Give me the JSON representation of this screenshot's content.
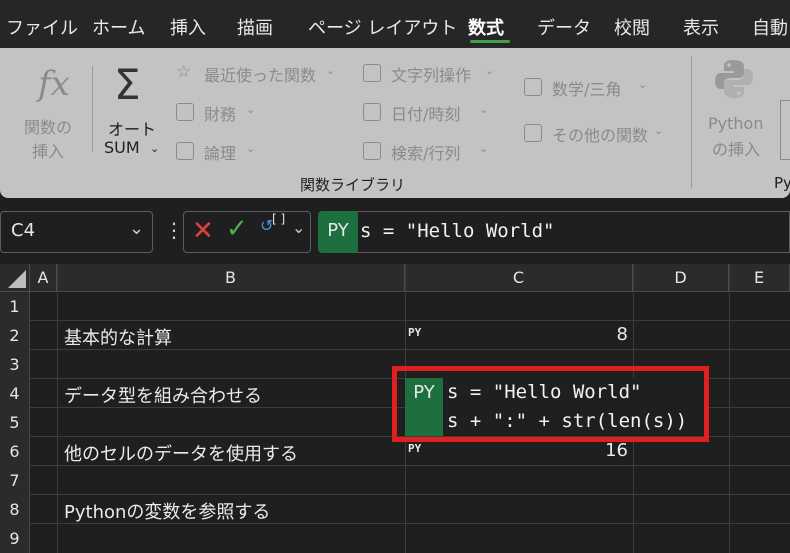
{
  "menu": {
    "tabs": [
      "ファイル",
      "ホーム",
      "挿入",
      "描画",
      "ページ レイアウト",
      "数式",
      "データ",
      "校閲",
      "表示",
      "自動"
    ],
    "active_tab": "数式"
  },
  "ribbon": {
    "insert_function": {
      "icon": "fx-icon",
      "label_line1": "関数の",
      "label_line2": "挿入"
    },
    "autosum": {
      "icon": "sigma-icon",
      "label_line1": "オート",
      "label_line2": "SUM"
    },
    "col1": [
      "最近使った関数",
      "財務",
      "論理"
    ],
    "col2": [
      "文字列操作",
      "日付/時刻",
      "検索/行列"
    ],
    "col3": [
      "数学/三角",
      "その他の関数"
    ],
    "python": {
      "icon": "python-logo-icon",
      "label_line1": "Python",
      "label_line2": "の挿入"
    },
    "group_label": "関数ライブラリ",
    "group_label_partial": "Py"
  },
  "formula_bar": {
    "name_box": "C4",
    "prefix": "PY",
    "formula": "s = \"Hello World\""
  },
  "grid": {
    "columns": [
      "A",
      "B",
      "C",
      "D",
      "E"
    ],
    "rows": [
      "1",
      "2",
      "3",
      "4",
      "5",
      "6",
      "7",
      "8",
      "9"
    ],
    "cells": {
      "B2": "基本的な計算",
      "B4": "データ型を組み合わせる",
      "B6": "他のセルのデータを使用する",
      "B8": "Pythonの変数を参照する",
      "C2": "8",
      "C6": "16"
    },
    "py_mini_badge": "PY",
    "c4_prefix": "PY",
    "c4_line1": "s = \"Hello World\"",
    "c4_line2": "s + \":\" + str(len(s))"
  },
  "colors": {
    "accent_green": "#1e6f3f",
    "highlight_red": "#e02020"
  }
}
